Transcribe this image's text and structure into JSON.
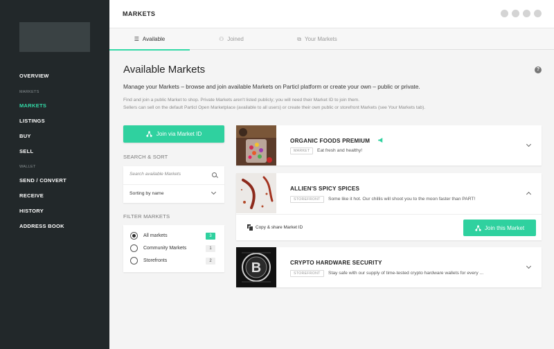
{
  "sidebar": {
    "items": [
      {
        "label": "OVERVIEW"
      },
      {
        "label": "MARKETS"
      },
      {
        "label": "LISTINGS"
      },
      {
        "label": "BUY"
      },
      {
        "label": "SELL"
      },
      {
        "label": "SEND / CONVERT"
      },
      {
        "label": "RECEIVE"
      },
      {
        "label": "HISTORY"
      },
      {
        "label": "ADDRESS BOOK"
      }
    ],
    "sections": {
      "markets": "MARKETS",
      "wallet": "WALLET"
    }
  },
  "header": {
    "title": "MARKETS"
  },
  "tabs": [
    {
      "label": "Available",
      "icon": "list-icon"
    },
    {
      "label": "Joined",
      "icon": "network-icon"
    },
    {
      "label": "Your Markets",
      "icon": "store-icon"
    }
  ],
  "main": {
    "title": "Available Markets",
    "lead": "Manage your Markets – browse and join available Markets on Particl platform or create your own – public or private.",
    "sub1": "Find and join a public Market to shop. Private Markets aren't listed publicly; you will need their Market ID to join them.",
    "sub2": "Sellers can sell on the default Particl Open Marketplace (available to all users) or create their own public or storefront Markets (see Your Markets tab)."
  },
  "left": {
    "join_via_id": "Join via Market ID",
    "search_sort_label": "SEARCH & SORT",
    "search_placeholder": "Search available Markets",
    "sort_value": "Sorting by name",
    "filter_label": "FILTER MARKETS",
    "filters": [
      {
        "label": "All markets",
        "count": "3",
        "checked": true
      },
      {
        "label": "Community Markets",
        "count": "1",
        "checked": false
      },
      {
        "label": "Storefronts",
        "count": "2",
        "checked": false
      }
    ]
  },
  "markets": [
    {
      "title": "ORGANIC FOODS PREMIUM",
      "tag": "MARKET",
      "desc": "Eat fresh and healthy!"
    },
    {
      "title": "ALLIEN'S SPICY SPICES",
      "tag": "STOREFRONT",
      "desc": "Some like it hot. Our chillis will shoot you to the moon faster than PART!",
      "copy_share": "Copy & share Market ID",
      "join_label": "Join this Market"
    },
    {
      "title": "CRYPTO HARDWARE SECURITY",
      "tag": "STOREFRONT",
      "desc": "Stay safe with our supply of time-tested crypto hardware wallets for every ..."
    }
  ],
  "colors": {
    "accent": "#2fd19f",
    "sidebar_bg": "#22282a"
  }
}
